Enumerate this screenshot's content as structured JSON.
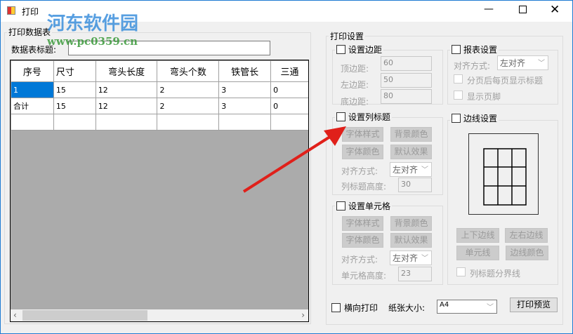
{
  "window": {
    "title": "打印",
    "watermark": "河东软件园",
    "watermark_url": "www.pc0359.cn"
  },
  "left": {
    "group_label": "打印数据表",
    "title_label": "数据表标题:",
    "title_value": "",
    "columns": [
      "序号",
      "尺寸",
      "弯头长度",
      "弯头个数",
      "铁管长",
      "三通"
    ],
    "rows": [
      [
        "1",
        "15",
        "12",
        "2",
        "3",
        "0"
      ],
      [
        "合计",
        "15",
        "12",
        "2",
        "3",
        "0"
      ],
      [
        "",
        "",
        "",
        "",
        "",
        ""
      ]
    ]
  },
  "right": {
    "group_label": "打印设置",
    "margin": {
      "label": "设置边距",
      "top_label": "顶边距:",
      "top": "60",
      "left_label": "左边距:",
      "left": "50",
      "bottom_label": "底边距:",
      "bottom": "80"
    },
    "report": {
      "label": "报表设置",
      "align_label": "对齐方式:",
      "align": "左对齐",
      "repeat_title": "分页后每页显示标题",
      "footer": "显示页脚"
    },
    "col_title": {
      "label": "设置列标题",
      "font_style": "字体样式",
      "bg_color": "背景颜色",
      "font_color": "字体颜色",
      "default": "默认效果",
      "align_label": "对齐方式:",
      "align": "左对齐",
      "height_label": "列标题高度:",
      "height": "30"
    },
    "cell": {
      "label": "设置单元格",
      "font_style": "字体样式",
      "bg_color": "背景颜色",
      "font_color": "字体颜色",
      "default": "默认效果",
      "align_label": "对齐方式:",
      "align": "左对齐",
      "height_label": "单元格高度:",
      "height": "23"
    },
    "border": {
      "label": "边线设置",
      "tb": "上下边线",
      "lr": "左右边线",
      "cell": "单元线",
      "color": "边线颜色",
      "header_sep": "列标题分界线"
    },
    "landscape": "横向打印",
    "paper_label": "纸张大小:",
    "paper": "A4",
    "preview": "打印预览"
  }
}
